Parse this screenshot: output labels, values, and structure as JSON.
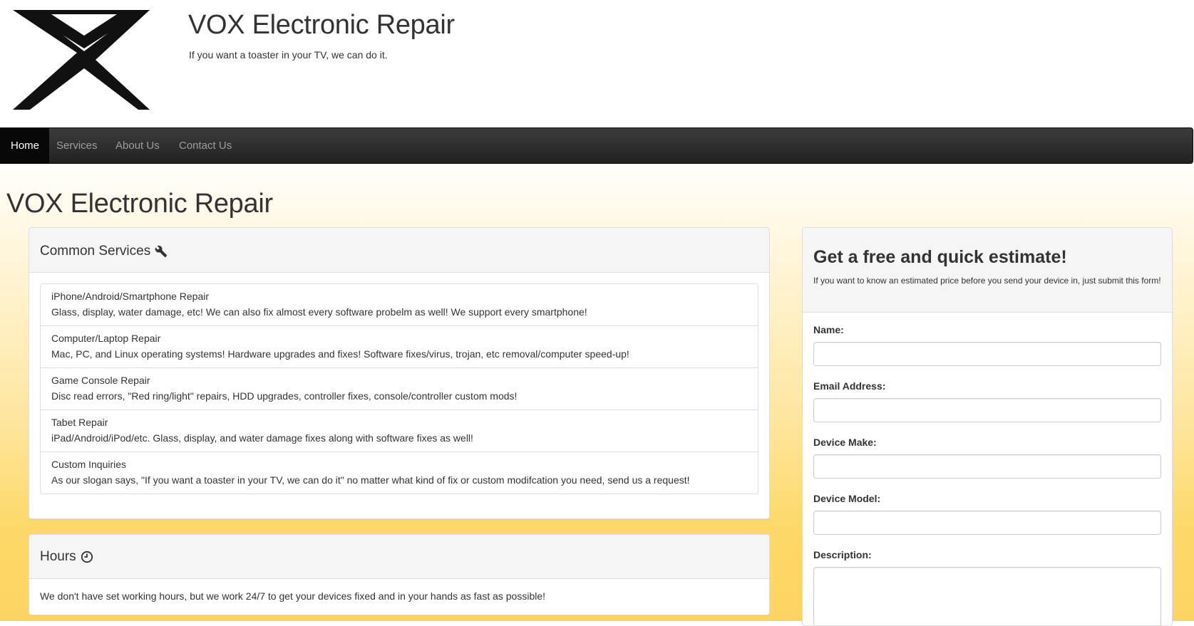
{
  "header": {
    "site_title": "VOX Electronic Repair",
    "tagline": "If you want a toaster in your TV, we can do it."
  },
  "nav": {
    "items": [
      "Home",
      "Services",
      "About Us",
      "Contact Us"
    ],
    "active": "Home"
  },
  "main": {
    "heading": "VOX Electronic Repair",
    "services": {
      "title": "Common Services",
      "icon": "wrench-icon",
      "items": [
        {
          "title": "iPhone/Android/Smartphone Repair",
          "text": "Glass, display, water damage, etc! We can also fix almost every software probelm as well! We support every smartphone!"
        },
        {
          "title": "Computer/Laptop Repair",
          "text": "Mac, PC, and Linux operating systems! Hardware upgrades and fixes! Software fixes/virus, trojan, etc removal/computer speed-up!"
        },
        {
          "title": "Game Console Repair",
          "text": "Disc read errors, \"Red ring/light\" repairs, HDD upgrades, controller fixes, console/controller custom mods!"
        },
        {
          "title": "Tabet Repair",
          "text": "iPad/Android/iPod/etc. Glass, display, and water damage fixes along with software fixes as well!"
        },
        {
          "title": "Custom Inquiries",
          "text": "As our slogan says, \"If you want a toaster in your TV, we can do it\" no matter what kind of fix or custom modifcation you need, send us a request!"
        }
      ]
    },
    "hours": {
      "title": "Hours",
      "icon": "clock-icon",
      "text": "We don't have set working hours, but we work 24/7 to get your devices fixed and in your hands as fast as possible!"
    }
  },
  "estimate": {
    "title": "Get a free and quick estimate!",
    "description": "If you want to know an estimated price before you send your device in, just submit this form!",
    "fields": {
      "name": {
        "label": "Name:",
        "value": ""
      },
      "email": {
        "label": "Email Address:",
        "value": ""
      },
      "make": {
        "label": "Device Make:",
        "value": ""
      },
      "model": {
        "label": "Device Model:",
        "value": ""
      },
      "description": {
        "label": "Description:",
        "value": ""
      }
    }
  },
  "colors": {
    "navbar": "#222222",
    "nav_active": "#080808",
    "gradient_end": "#fdd463"
  }
}
